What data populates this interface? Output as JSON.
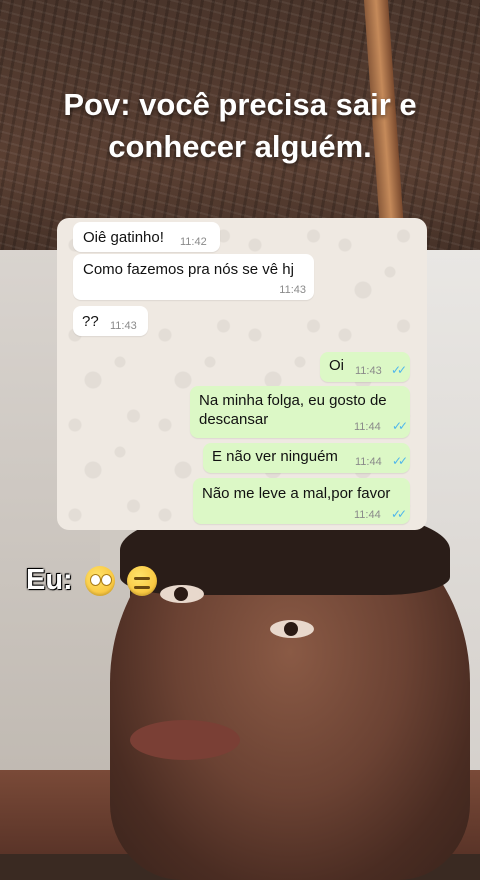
{
  "caption": {
    "line1": "Pov: você precisa sair e",
    "line2": "conhecer alguém."
  },
  "chat": {
    "messages": [
      {
        "direction": "in",
        "text": "Oiê gatinho!",
        "time": "11:42"
      },
      {
        "direction": "in",
        "text": "Como fazemos pra nós se vê hj",
        "time": "11:43"
      },
      {
        "direction": "in",
        "text": "??",
        "time": "11:43"
      },
      {
        "direction": "out",
        "text": "Oi",
        "time": "11:43",
        "status": "read"
      },
      {
        "direction": "out",
        "text_line1": "Na minha folga, eu gosto de",
        "text_line2": "descansar",
        "time": "11:44",
        "status": "read"
      },
      {
        "direction": "out",
        "text": "E não ver ninguém",
        "time": "11:44",
        "status": "read"
      },
      {
        "direction": "out",
        "text": "Não me leve a mal,por favor",
        "time": "11:44",
        "status": "read"
      }
    ]
  },
  "reaction": {
    "label": "Eu:",
    "emojis": [
      "face-with-rolling-eyes-icon",
      "expressionless-face-icon"
    ]
  },
  "colors": {
    "incoming_bubble": "#ffffff",
    "outgoing_bubble": "#dcf8c6",
    "read_tick": "#4fb6ec"
  }
}
